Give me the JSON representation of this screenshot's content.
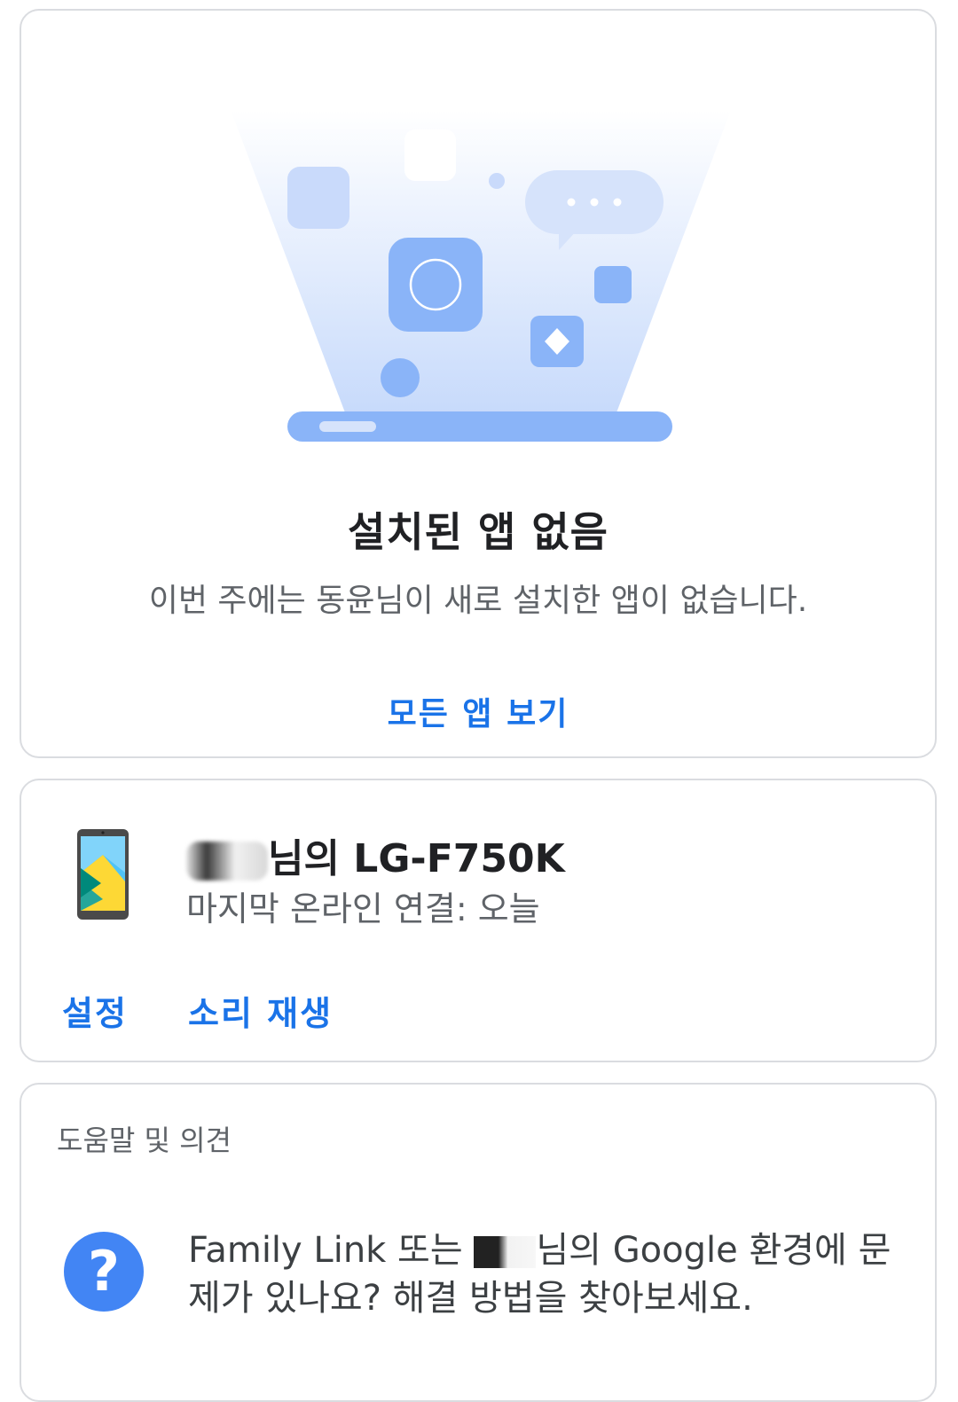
{
  "apps_card": {
    "title": "설치된 앱 없음",
    "description": "이번 주에는 동윤님이 새로 설치한 앱이 없습니다.",
    "view_all_label": "모든 앱 보기",
    "illustration_icons": [
      "app-tile-icon",
      "chat-bubble-icon",
      "camera-app-icon",
      "diamond-app-icon",
      "laptop-icon"
    ]
  },
  "device_card": {
    "name_suffix": "님의 LG-F750K",
    "status": "마지막 온라인 연결: 오늘",
    "settings_label": "설정",
    "play_sound_label": "소리 재생",
    "icon": "smartphone-icon"
  },
  "help_card": {
    "header": "도움말 및 의견",
    "text_part1": "Family Link 또는",
    "text_part2": "님의 Google 환경에 문제가 있나요? 해결 방법을 찾아보세요.",
    "icon": "help-circle-icon"
  },
  "colors": {
    "accent": "#1a73e8",
    "illustration_light": "#dbe7fc",
    "illustration_mid": "#8ab4f8",
    "help_icon": "#4285f4"
  }
}
